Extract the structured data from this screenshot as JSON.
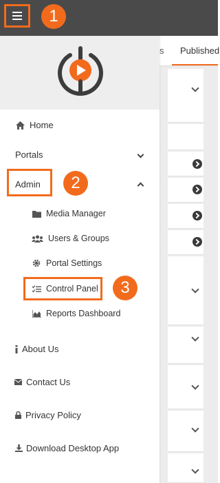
{
  "callouts": [
    "1",
    "2",
    "3"
  ],
  "background": {
    "tab_partial": "s",
    "tab_published": "Published"
  },
  "sidebar": {
    "home": "Home",
    "portals": "Portals",
    "admin": "Admin",
    "admin_items": {
      "media_manager": "Media Manager",
      "users_groups": "Users & Groups",
      "portal_settings": "Portal Settings",
      "control_panel": "Control Panel",
      "reports_dashboard": "Reports Dashboard"
    },
    "about": "About Us",
    "contact": "Contact Us",
    "privacy": "Privacy Policy",
    "download": "Download Desktop App"
  },
  "colors": {
    "accent": "#f26b1d",
    "topbar": "#4a4a4a"
  }
}
